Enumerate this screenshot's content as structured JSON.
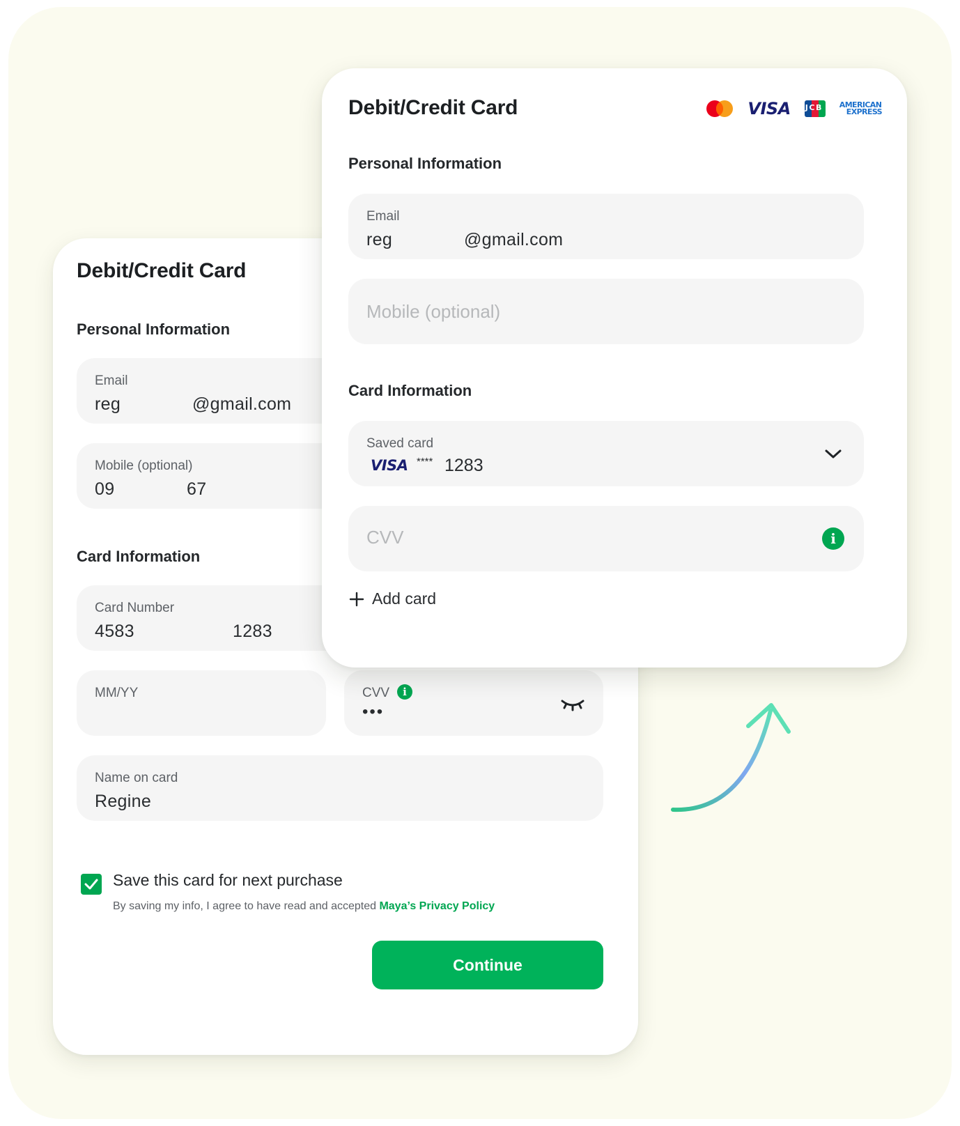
{
  "back_card": {
    "title": "Debit/Credit Card",
    "personal_section": "Personal Information",
    "email": {
      "label": "Email",
      "value_prefix": "reg",
      "value_suffix": "@gmail.com"
    },
    "mobile": {
      "label": "Mobile (optional)",
      "value_prefix": "09",
      "value_suffix": "67"
    },
    "card_section": "Card Information",
    "card_number": {
      "label": "Card Number",
      "value_prefix": "4583",
      "value_suffix": "1283"
    },
    "expiry": {
      "label": "MM/YY",
      "value": ""
    },
    "cvv": {
      "label": "CVV",
      "value": "•••"
    },
    "name_on_card": {
      "label": "Name on card",
      "value": "Regine"
    },
    "save_card": {
      "label": "Save this card for next purchase",
      "checked": true
    },
    "policy": {
      "text": "By saving my info, I agree to have read and accepted ",
      "link": "Maya’s Privacy Policy"
    },
    "continue_label": "Continue"
  },
  "front_card": {
    "title": "Debit/Credit Card",
    "logos": {
      "mastercard": "mastercard-logo",
      "visa": "VISA",
      "jcb": "JCB",
      "amex_line1": "AMERICAN",
      "amex_line2": "EXPRESS"
    },
    "personal_section": "Personal Information",
    "email": {
      "label": "Email",
      "value_prefix": "reg",
      "value_suffix": "@gmail.com"
    },
    "mobile": {
      "placeholder": "Mobile (optional)"
    },
    "card_section": "Card Information",
    "saved_card": {
      "label": "Saved card",
      "brand": "VISA",
      "mask": "****",
      "last4": "1283"
    },
    "cvv": {
      "placeholder": "CVV"
    },
    "add_card_label": "Add card"
  },
  "colors": {
    "accent": "#00a651",
    "button": "#00b25a",
    "background": "#fbfbef",
    "field": "#f5f5f5",
    "visa_blue": "#1a1f71"
  },
  "icons": [
    "mastercard-logo",
    "visa-logo",
    "jcb-logo",
    "amex-logo",
    "chevron-down-icon",
    "info-icon",
    "eye-closed-icon",
    "check-icon",
    "plus-icon",
    "curved-arrow-icon"
  ]
}
